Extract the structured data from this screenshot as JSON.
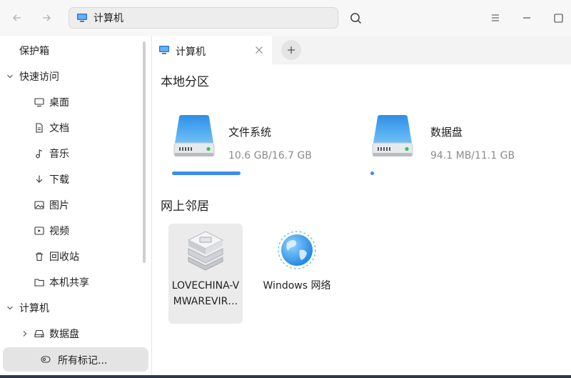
{
  "toolbar": {
    "address": "计算机"
  },
  "sidebar": {
    "items": [
      {
        "label": "保护箱"
      },
      {
        "label": "快速访问"
      },
      {
        "label": "桌面"
      },
      {
        "label": "文档"
      },
      {
        "label": "音乐"
      },
      {
        "label": "下载"
      },
      {
        "label": "图片"
      },
      {
        "label": "视频"
      },
      {
        "label": "回收站"
      },
      {
        "label": "本机共享"
      },
      {
        "label": "计算机"
      },
      {
        "label": "数据盘"
      }
    ],
    "tags_label": "所有标记..."
  },
  "tabs": [
    {
      "label": "计算机"
    }
  ],
  "main": {
    "local_section": "本地分区",
    "disks": [
      {
        "name": "文件系统",
        "size": "10.6 GB/16.7 GB",
        "used": 10.6,
        "total": 16.7
      },
      {
        "name": "数据盘",
        "size": "94.1 MB/11.1 GB",
        "used": 0.0941,
        "total": 11.1
      }
    ],
    "network_section": "网上邻居",
    "network_items": [
      {
        "label": "LOVECHINA-VMWAREVIR…"
      },
      {
        "label": "Windows 网络"
      }
    ]
  },
  "colors": {
    "accent": "#3d8bf0",
    "disk_blue": "#4aa8ef"
  }
}
